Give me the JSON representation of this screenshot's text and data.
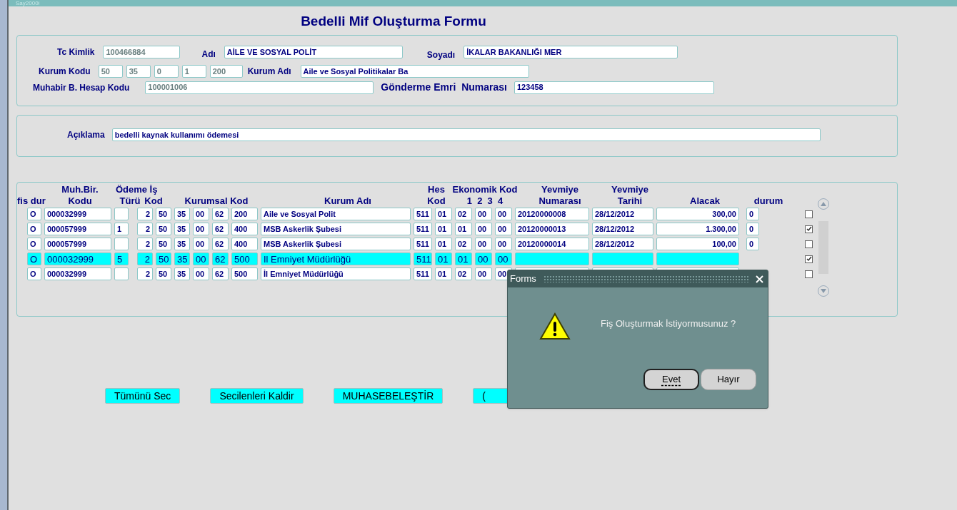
{
  "window": {
    "title": "Say2000i"
  },
  "form_title": "Bedelli Mif Oluşturma Formu",
  "header": {
    "tc_kimlik": {
      "label": "Tc Kimlik",
      "value": "100466884",
      "disabled": true
    },
    "adi": {
      "label": "Adı",
      "value": "AİLE VE SOSYAL POLİT",
      "disabled": false
    },
    "soyadi": {
      "label": "Soyadı",
      "value": "İKALAR BAKANLIĞI MER",
      "disabled": false
    },
    "kurum_kodu": {
      "label": "Kurum Kodu",
      "values": [
        "50",
        "35",
        "0",
        "1",
        "200"
      ],
      "disabled": true
    },
    "kurum_adi": {
      "label": "Kurum Adı",
      "value": "Aile ve Sosyal Politikalar Ba",
      "disabled": false
    },
    "muhabir": {
      "label": "Muhabir B. Hesap Kodu",
      "value": "100001006",
      "disabled": true
    },
    "gonderme": {
      "label": "Gönderme Emri  Numarası",
      "value": "123458",
      "disabled": false
    }
  },
  "aciklama": {
    "label": "Açıklama",
    "value": "bedelli kaynak kullanımı ödemesi"
  },
  "table": {
    "columns": [
      [
        "fis dur"
      ],
      [
        "Muh.Bir.",
        "Kodu"
      ],
      [
        "Ödeme",
        "Türü"
      ],
      [
        "İş",
        "Kod"
      ],
      [
        "Kurumsal Kod"
      ],
      [
        "Kurum Adı"
      ],
      [
        "Hes",
        "Kod"
      ],
      [
        "Ekonomik Kod",
        "1  2  3  4"
      ],
      [
        "Yevmiye",
        "Numarası"
      ],
      [
        "Yevmiye",
        "Tarihi"
      ],
      [
        "Alacak"
      ],
      [
        "durum"
      ]
    ],
    "rows": [
      {
        "selected": false,
        "checked": false,
        "fis_dur": "O",
        "muh_kodu": "000032999",
        "turu": "",
        "is_kod": "2",
        "kurumsal": [
          "50",
          "35",
          "00",
          "62",
          "200"
        ],
        "kurum_adi": "Aile ve Sosyal Polit",
        "hes_kod": "511",
        "ekonomik": [
          "01",
          "02",
          "00",
          "00"
        ],
        "yevmiye_no": "20120000008",
        "tarih": "28/12/2012",
        "alacak": "300,00",
        "durum": "0"
      },
      {
        "selected": false,
        "checked": true,
        "fis_dur": "O",
        "muh_kodu": "000057999",
        "turu": "1",
        "is_kod": "2",
        "kurumsal": [
          "50",
          "35",
          "00",
          "62",
          "400"
        ],
        "kurum_adi": "MSB Askerlik Şubesi",
        "hes_kod": "511",
        "ekonomik": [
          "01",
          "01",
          "00",
          "00"
        ],
        "yevmiye_no": "20120000013",
        "tarih": "28/12/2012",
        "alacak": "1.300,00",
        "durum": "0"
      },
      {
        "selected": false,
        "checked": false,
        "fis_dur": "O",
        "muh_kodu": "000057999",
        "turu": "",
        "is_kod": "2",
        "kurumsal": [
          "50",
          "35",
          "00",
          "62",
          "400"
        ],
        "kurum_adi": "MSB Askerlik Şubesi",
        "hes_kod": "511",
        "ekonomik": [
          "01",
          "02",
          "00",
          "00"
        ],
        "yevmiye_no": "20120000014",
        "tarih": "28/12/2012",
        "alacak": "100,00",
        "durum": "0"
      },
      {
        "selected": true,
        "checked": true,
        "fis_dur": "O",
        "muh_kodu": "000032999",
        "turu": "5",
        "is_kod": "2",
        "kurumsal": [
          "50",
          "35",
          "00",
          "62",
          "500"
        ],
        "kurum_adi": "Il Emniyet Müdürlüğü",
        "hes_kod": "511",
        "ekonomik": [
          "01",
          "01",
          "00",
          "00"
        ]
      },
      {
        "selected": false,
        "checked": false,
        "fis_dur": "O",
        "muh_kodu": "000032999",
        "turu": "",
        "is_kod": "2",
        "kurumsal": [
          "50",
          "35",
          "00",
          "62",
          "500"
        ],
        "kurum_adi": "İl Emniyet Müdürlüğü",
        "hes_kod": "511",
        "ekonomik": [
          "01",
          "02",
          "00",
          "00"
        ]
      }
    ]
  },
  "buttons": [
    "Tümünü Sec",
    "Secilenleri Kaldir",
    "MUHASEBELEŞTİR",
    "("
  ],
  "dialog": {
    "title": "Forms",
    "message": "Fiş Oluşturmak İstiyormusunuz ?",
    "buttons": [
      {
        "label": "Evet",
        "selected": true
      },
      {
        "label": "Hayır",
        "selected": false
      }
    ]
  }
}
